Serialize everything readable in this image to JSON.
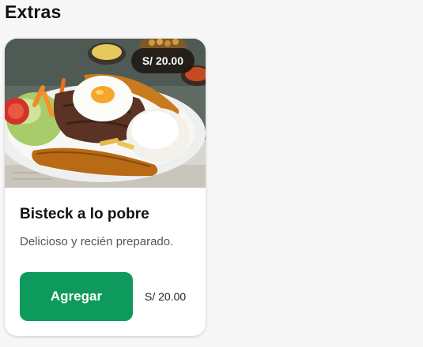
{
  "section": {
    "title": "Extras"
  },
  "product": {
    "image_alt": "Bisteck a lo pobre",
    "price_badge": "S/ 20.00",
    "name": "Bisteck a lo pobre",
    "description": "Delicioso y recién preparado.",
    "add_label": "Agregar",
    "price": "S/ 20.00"
  },
  "colors": {
    "accent": "#0d9a5c",
    "badge_bg": "#1c1612"
  }
}
